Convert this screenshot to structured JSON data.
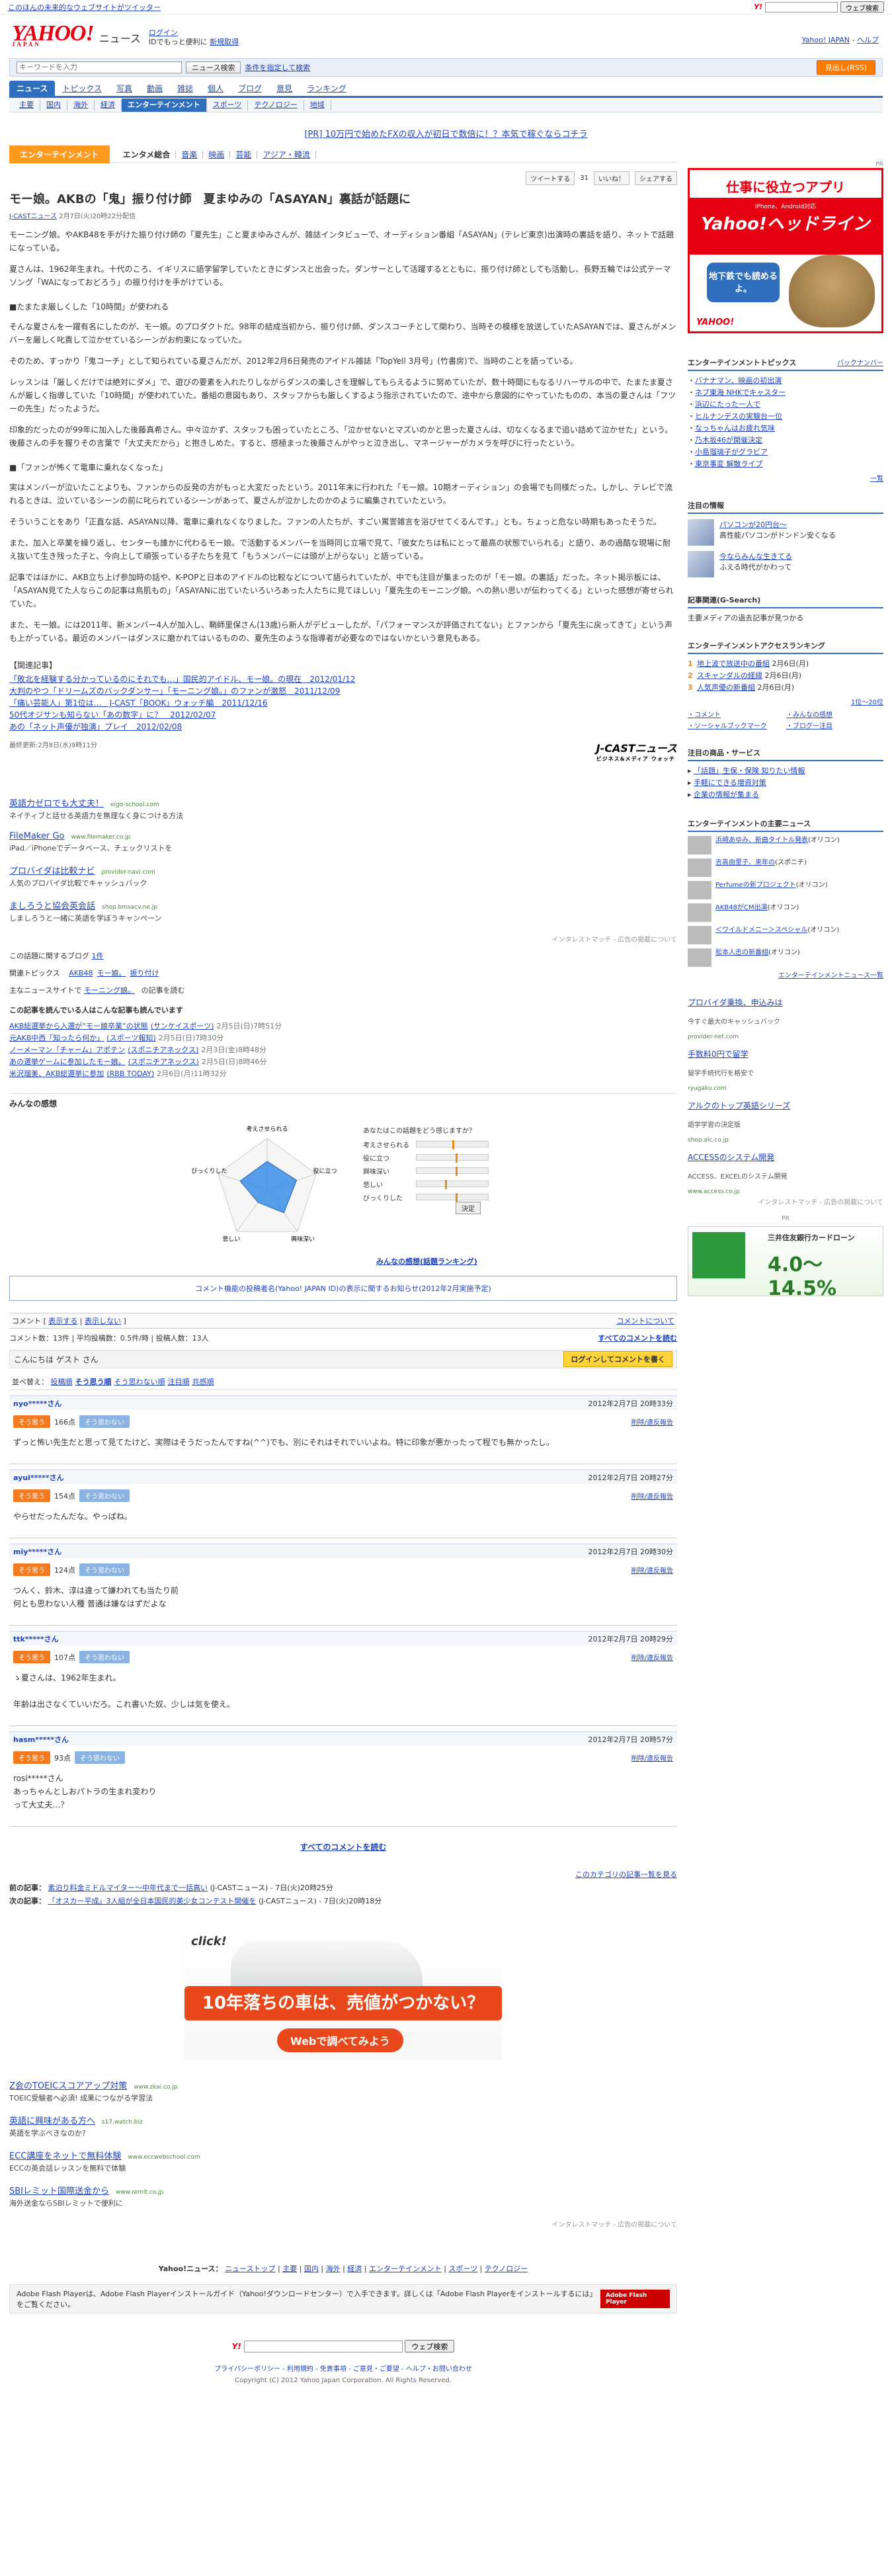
{
  "topbar": {
    "left_link": "このほんの未来的なウェブサイトがツイッター",
    "search_button": "ウェブ検索"
  },
  "header": {
    "logo_text": "YAHOO!",
    "logo_sub": "JAPAN",
    "section": "ニュース",
    "login_link": "ログイン",
    "login_text": "IDでもっと便利に",
    "signup_link": "新規取得",
    "right_link": "Yahoo! JAPAN",
    "right_link2": "ヘルプ"
  },
  "search": {
    "placeholder": "キーワードを入力",
    "button": "ニュース検索",
    "cond": "条件を指定して検索",
    "orange": "見出し(RSS)"
  },
  "nav1": [
    "ニュース",
    "トピックス",
    "写真",
    "動画",
    "雑誌",
    "個人",
    "ブログ",
    "意見",
    "ランキング"
  ],
  "nav2": [
    "主要",
    "国内",
    "海外",
    "経済",
    "エンターテインメント",
    "スポーツ",
    "テクノロジー",
    "地域"
  ],
  "nav2_active": 4,
  "pr_line": "[PR] 10万円で始めたFXの収入が初日で数倍に！？本気で稼ぐならコチラ",
  "catbar": {
    "label": "エンターテインメント",
    "items": [
      "エンタメ総合",
      "音楽",
      "映画",
      "芸能",
      "アジア・韓流"
    ],
    "bold_index": 0
  },
  "share": {
    "tweet": "ツイートする",
    "tweet_count": "31",
    "like": "いいね！",
    "share": "シェアする"
  },
  "article": {
    "title": "モー娘。AKBの「鬼」振り付け師　夏まゆみの「ASAYAN」裏話が話題に",
    "source": "J-CASTニュース",
    "date": "2月7日(火)20時22分配信",
    "p1": "モーニング娘。やAKB48を手がけた振り付け師の「夏先生」こと夏まゆみさんが、雑誌インタビューで、オーディション番組「ASAYAN」(テレビ東京)出演時の裏話を語り、ネットで話題になっている。",
    "p2": "夏さんは、1962年生まれ。十代のころ、イギリスに語学留学していたときにダンスと出会った。ダンサーとして活躍するとともに、振り付け師としても活動し、長野五輪では公式テーマソング「WAになっておどろう」の振り付けを手がけている。",
    "h1": "■たまたま厳しくした「10時間」が使われる",
    "p3": "そんな夏さんを一躍有名にしたのが、モー娘。のプロダクトだ。98年の結成当初から、振り付け師、ダンスコーチとして関わり、当時その模様を放送していたASAYANでは、夏さんがメンバーを厳しく叱責して泣かせているシーンがお約束になっていた。",
    "p4": "そのため、すっかり「鬼コーチ」として知られている夏さんだが、2012年2月6日発売のアイドル雑誌「TopYell 3月号」(竹書房)で、当時のことを語っている。",
    "p5": "レッスンは「厳しくだけでは絶対にダメ」で、遊びの要素を入れたりしながらダンスの楽しさを理解してもらえるように努めていたが、数十時間にもなるリハーサルの中で、たまたま夏さんが厳しく指導していた「10時間」が使われていた。番組の意図もあり、スタッフからも厳しくするよう指示されていたので、途中から意図的にやっていたものの、本当の夏さんは「フツーの先生」だったようだ。",
    "p6": "印象的だったのが99年に加入した後藤真希さん。中々泣かず、スタッフも困っていたところ、「泣かせないとマズいのかと思った夏さんは、切なくなるまで追い詰めて泣かせた」という。後藤さんの手を握りその言葉で「大丈夫だから」と抱きしめた。すると、感極まった後藤さんがやっと泣き出し、マネージャーがカメラを呼びに行ったという。",
    "h2": "■「ファンが怖くて電車に乗れなくなった」",
    "p7": "実はメンバーが泣いたことよりも、ファンからの反発の方がもっと大変だったという。2011年末に行われた「モー娘。10期オーディション」の会場でも同様だった。しかし、テレビで流れるときは、泣いているシーンの前に叱られているシーンがあって、夏さんが泣かしたのかのように編集されていたという。",
    "p8": "そういうことをあり「正直な話、ASAYAN以降、電車に乗れなくなりました。ファンの人たちが、すごい罵詈雑言を浴びせてくるんです。」とも。ちょっと危ない時期もあったそうだ。",
    "p9": "また、加入と卒業を繰り返し、センターも誰かに代わるモー娘。で活動するメンバーを当時同じ立場で見て、「彼女たちは私にとって最高の状態でいられる」と語り、あの過酷な現場に耐え抜いて生き残った子と、今向上して頑張っている子たちを見て「もうメンバーには頭が上がらない」と語っている。",
    "p10": "記事ではほかに、AKB立ち上げ参加時の話や、K-POPと日本のアイドルの比較などについて語られていたが、中でも注目が集まったのが「モー娘。の裏話」だった。ネット掲示板には、「ASAYAN見てた人ならこの記事は鳥肌もの」「ASAYANに出ていたいろいろあった人たちに見てほしい」「夏先生のモーニング娘。への熱い思いが伝わってくる」といった感想が寄せられていた。",
    "p11": "また、モー娘。には2011年、新メンバー4人が加入し、鞘師里保さん(13歳)ら新人がデビューしたが、「パフォーマンスが評価されてない」とファンから「夏先生に戻ってきて」という声も上がっている。最近のメンバーはダンスに磨かれてはいるものの、夏先生のような指導者が必要なのではないかという意見もある。",
    "related_head": "【関連記事】",
    "related": [
      "「敗北を経験する分かっているのにそれでも…」国民的アイドル、モー娘。の現在　2012/01/12",
      "大判のやつ「ドリームズのバックダンサー」「モーニング娘。」のファンが激怒　2011/12/09",
      "「痛い芸能人」第1位は…　J-CAST「BOOK」ウォッチ編　2011/12/16",
      "50代オジサンも知らない「あの数字」に？　2012/02/07",
      "あの「ネット声優が独演」プレイ　2012/02/08"
    ],
    "datestamp": "最終更新:2月8日(水)9時11分",
    "jcast": "J-CASTニュース",
    "jcast_sub": "ビジネス&メディア ウォッチ"
  },
  "ads": [
    {
      "t": "英語力ゼロでも大丈夫！",
      "u": "eigo-school.com",
      "d": "ネイティブと話せる英語力を無理なく身につける方法"
    },
    {
      "t": "FileMaker Go",
      "u": "www.filemaker.co.jp",
      "d": "iPad／iPhoneでデータベース、チェックリストを"
    },
    {
      "t": "プロバイダは比較ナビ",
      "u": "provider-navi.com",
      "d": "人気のプロバイダ比較でキャッシュバック"
    },
    {
      "t": "ましろうと協会英会話",
      "u": "shop.bmsacv.ne.jp",
      "d": "しましろうと一緒に英語を学ぼうキャンペーン"
    }
  ],
  "inter": "インタレストマッチ - 広告の掲載について",
  "topics_line": {
    "label": "この話題に関するブログ",
    "count": "1件"
  },
  "relate_line": {
    "label": "関連トピックス",
    "items": [
      "AKB48",
      "モー娘。",
      "振り付け"
    ]
  },
  "mainsite": {
    "label": "主なニュースサイトで",
    "keyword": "モーニング娘。",
    "tail": "の記事を読む"
  },
  "alsoread": {
    "head": "この記事を読んでいる人はこんな記事も読んでいます",
    "items": [
      {
        "t": "AKB総選挙から入選が“モー娘卒業”の状態",
        "s": "(サンケイスポーツ)",
        "d": "2月5日(日)7時51分"
      },
      {
        "t": "元AKB中西「知ったら何か」",
        "s": "(スポーツ報知)",
        "d": "2月5日(日)7時30分"
      },
      {
        "t": "ノーメーマン「チャーム」アポテン",
        "s": "(スポニチアネックス)",
        "d": "2月3日(金)8時48分"
      },
      {
        "t": "あの選挙ゲームに参加したモー娘。",
        "s": "(スポニチアネックス)",
        "d": "2月5日(日)8時46分"
      },
      {
        "t": "米沢瑠美、AKB総選挙に参加",
        "s": "(RBB TODAY)",
        "d": "2月6日(月)11時32分"
      }
    ]
  },
  "feel": {
    "head": "みんなの感想",
    "q": "あなたはこの話題をどう感じますか？",
    "axes": [
      "考えさせられる",
      "役に立つ",
      "興味深い",
      "悲しい",
      "びっくりした"
    ],
    "values": [
      0.55,
      0.6,
      0.55,
      0.3,
      0.55
    ],
    "marker": [
      0.5,
      0.55,
      0.55,
      0.4,
      0.55
    ],
    "button": "決定",
    "rank": "みんなの感想(話題ランキング)"
  },
  "notice": "コメント機能の投稿者名(Yahoo! JAPAN ID)の表示に関するお知らせ(2012年2月実施予定)",
  "comments_bar": {
    "label": "コメント",
    "show": "表示する",
    "hide": "表示しない",
    "right": "コメントについて"
  },
  "comments_meta": {
    "count": "コメント数：13件",
    "avg": "平均投稿数：0.5件/時",
    "posters": "投稿人数：13人",
    "all": "すべてのコメントを読む"
  },
  "guest": {
    "text": "こんにちは ゲスト さん",
    "button": "ログインしてコメントを書く"
  },
  "sort": {
    "label": "並べ替え",
    "items": [
      "投稿順",
      "そう思う順",
      "そう思わない順",
      "注目順",
      "共感順"
    ],
    "selected": 1
  },
  "comments": [
    {
      "name": "nyo*****さん",
      "date": "2012年2月7日 20時33分",
      "agree": "166点",
      "text": "ずっと怖い先生だと思って見てたけど、実際はそうだったんですね(^^)でも、別にそれはそれでいいよね。特に印象が悪かったって程でも無かったし。"
    },
    {
      "name": "ayui*****さん",
      "date": "2012年2月7日 20時27分",
      "agree": "154点",
      "text": "やらせだったんだな。やっぱね。"
    },
    {
      "name": "miy*****さん",
      "date": "2012年2月7日 20時30分",
      "agree": "124点",
      "text": "つんく、鈴木、淳は違って嫌われても当たり前\n何とも思わない人種 普通は嫌なはずだよな"
    },
    {
      "name": "ttk*****さん",
      "date": "2012年2月7日 20時29分",
      "agree": "107点",
      "text": "ゝ夏さんは、1962年生まれ。\n\n年齢は出さなくていいだろ。これ書いた奴、少しは気を使え。"
    },
    {
      "name": "hasm*****さん",
      "date": "2012年2月7日 20時57分",
      "agree": "93点",
      "text": "rosi*****さん\nあっちゃんとしおパトラの生まれ変わり\nって大丈夫…？"
    }
  ],
  "comment_labels": {
    "agree": "そう思う",
    "disagree": "そう思わない",
    "del": "削除/違反報告"
  },
  "all_comments": "すべてのコメントを読む",
  "prevnext": {
    "prev": "前の記事：",
    "prev_link": "素泊り料金ミドルマイター～中年代まで一括高い",
    "prev_src": "(J-CASTニュース)",
    "prev_date": "7日(火)20時25分",
    "next": "次の記事：",
    "next_link": "「オスカー平成」3人組が全日本国民的美少女コンテスト開催を",
    "next_src": "(J-CASTニュース)",
    "next_date": "7日(火)20時18分",
    "list_link": "このカテゴリの記事一覧を見る"
  },
  "bigad": {
    "click": "click!",
    "banner": "10年落ちの車は、売値がつかない？",
    "pill": "Webで調べてみよう"
  },
  "ads2": [
    {
      "t": "Z会のTOEICスコアアップ対策",
      "u": "www.zkai.co.jp",
      "d": "TOEIC受験者へ必須! 成果につながる学習法"
    },
    {
      "t": "英語に興味がある方へ",
      "u": "s17.watch.biz",
      "d": "英語を学ぶべきなのか?"
    },
    {
      "t": "ECC講座をネットで無料体験",
      "u": "www.eccwebschool.com",
      "d": "ECCの英会話レッスンを無料で体験"
    },
    {
      "t": "SBIレミット国際送金から",
      "u": "www.remit.co.jp",
      "d": "海外送金ならSBIレミットで便利に"
    }
  ],
  "foot_nav": {
    "label": "Yahoo!ニュース：",
    "items": [
      "ニューストップ",
      "主要",
      "国内",
      "海外",
      "経済",
      "エンターテインメント",
      "スポーツ",
      "テクノロジー"
    ]
  },
  "flash": {
    "text": "Adobe Flash Playerは、Adobe Flash Playerインストールガイド（Yahoo!ダウンロードセンター）で入手できます。詳しくは「Adobe Flash Playerをインストールするには」をご覧ください。",
    "button": "Adobe Flash Player"
  },
  "foot_search_button": "ウェブ検索",
  "foot_links": "プライバシーポリシー - 利用規約 - 免責事項 - ご意見・ご要望 - ヘルプ・お問い合わせ",
  "copyright": "Copyright (C) 2012 Yahoo Japan Corporation. All Rights Reserved.",
  "side": {
    "pr": "PR",
    "hdl_t1": "仕事に役立つアプリ",
    "hdl_sub": "iPhone、Android対応",
    "hdl_big": "Yahoo!ヘッドライン",
    "hdl_bubble": "地下鉄でも読めるよ。",
    "topics_head": "エンターテインメントトピックス",
    "topics_link": "バックナンバー",
    "topics": [
      "バナナマン、映画の初出演",
      "ネプ東海 NHKでキャスター",
      "浜辺にたった一人で",
      "ヒルナンデスの実験台一位",
      "なっちゃんはお疲れ気味",
      "乃木坂46が開催決定",
      "小島瑠璃子がグラビア",
      "東京事変 解散ライブ"
    ],
    "topics_more": "一覧",
    "pick_head": "注目の情報",
    "picks": [
      {
        "t": "パソコンが20円台〜",
        "d": "高性能パソコンがドンドン安くなる"
      },
      {
        "t": "今ならみんな生きてる",
        "d": "ふえる時代がかわって"
      }
    ],
    "access_head": "記事関連(G-Search)",
    "access_text": "主要メディアの過去記事が見つかる",
    "ranking_head": "エンターテインメントアクセスランキング",
    "ranking": [
      {
        "t": "地上波で放送中の番組",
        "d": "2月6日(月)"
      },
      {
        "t": "スキャンダルの経緯",
        "d": "2月6日(月)"
      },
      {
        "t": "人気声優の新番組",
        "d": "2月6日(月)"
      }
    ],
    "ranking_more": "1位〜20位",
    "rank_links": [
      "コメント",
      "みんなの感想",
      "ソーシャルブックマーク",
      "ブログ一注目"
    ],
    "svc_head": "注目の商品・サービス",
    "svc": [
      "「話題」生保・保険 知りたい情報",
      "手軽にできる増資対策",
      "企業の情報が集まる"
    ],
    "news_head": "エンターテインメントの主要ニュース",
    "news": [
      {
        "t": "浜崎あゆみ、新曲タイトル発表",
        "s": "(オリコン)"
      },
      {
        "t": "吉高由里子、来年の",
        "s": "(スポニチ)"
      },
      {
        "t": "Perfumeの新プロジェクト",
        "s": "(オリコン)"
      },
      {
        "t": "AKB48がCM出演",
        "s": "(オリコン)"
      },
      {
        "t": "＜ワイルドメニー＞スペシャル",
        "s": "(オリコン)"
      },
      {
        "t": "松本人志の新番組",
        "s": "(オリコン)"
      }
    ],
    "news_more": "エンターテインメントニュース一覧",
    "side_ads": [
      {
        "t": "プロバイダ乗換、申込みは",
        "d": "今すぐ最大のキャッシュバック",
        "u": "provider-net.com"
      },
      {
        "t": "手数料0円で留学",
        "d": "留学手続代行を格安で",
        "u": "ryugaku.com"
      },
      {
        "t": "アルクのトップ英語シリーズ",
        "d": "語学学習の決定版",
        "u": "shop.alc.co.jp"
      },
      {
        "t": "ACCESSのシステム開発",
        "d": "ACCESS、EXCELのシステム開発",
        "u": "www.access.co.jp"
      }
    ],
    "inter": "インタレストマッチ - 広告の掲載について",
    "pr2_name": "三井住友銀行カードローン",
    "pr2_rate": "4.0〜14.5%"
  }
}
